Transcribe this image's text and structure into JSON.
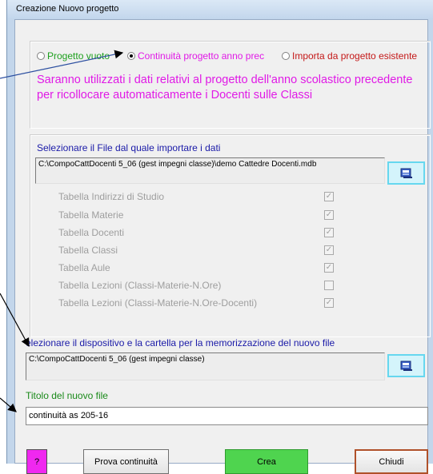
{
  "window": {
    "title": "Creazione Nuovo progetto"
  },
  "project_type": {
    "options": [
      {
        "label": "Progetto vuoto",
        "selected": false,
        "color": "#1ea01e"
      },
      {
        "label": "Continuità progetto anno prec",
        "selected": true,
        "color": "#e01ae6"
      },
      {
        "label": "Importa da progetto esistente",
        "selected": false,
        "color": "#c41818"
      }
    ],
    "description_line1": "Saranno utilizzati i dati relativi al progetto dell'anno scolastico precedente",
    "description_line2": "per ricollocare automaticamente i Docenti sulle Classi"
  },
  "import_source": {
    "label": "Selezionare il File dal quale importare i dati",
    "path": "C:\\CompoCattDocenti 5_06 (gest impegni classe)\\demo Cattedre Docenti.mdb",
    "browse_icon": "folder-browse-icon"
  },
  "tables": [
    {
      "label": "Tabella Indirizzi di Studio",
      "checked": true
    },
    {
      "label": "Tabella Materie",
      "checked": true
    },
    {
      "label": "Tabella Docenti",
      "checked": true
    },
    {
      "label": "Tabella Classi",
      "checked": true
    },
    {
      "label": "Tabella Aule",
      "checked": true
    },
    {
      "label": "Tabella Lezioni (Classi-Materie-N.Ore)",
      "checked": false
    },
    {
      "label": "Tabella Lezioni (Classi-Materie-N.Ore-Docenti)",
      "checked": true
    }
  ],
  "destination": {
    "label": "elezionare il dispositivo e la cartella per la memorizzazione del nuovo file",
    "path": "C:\\CompoCattDocenti 5_06 (gest impegni classe)",
    "browse_icon": "folder-browse-icon"
  },
  "new_file": {
    "label": "Titolo del nuovo file",
    "value": "continuità as 205-16"
  },
  "buttons": {
    "help_label": "?",
    "prova_label": "Prova continuità",
    "crea_label": "Crea",
    "chiudi_label": "Chiudi"
  },
  "colors": {
    "accent_magenta": "#e01ae6",
    "label_blue": "#1a1aa8",
    "label_green": "#1a8a1a",
    "crea_green": "#4fd44f",
    "chiudi_border": "#b0512a"
  }
}
